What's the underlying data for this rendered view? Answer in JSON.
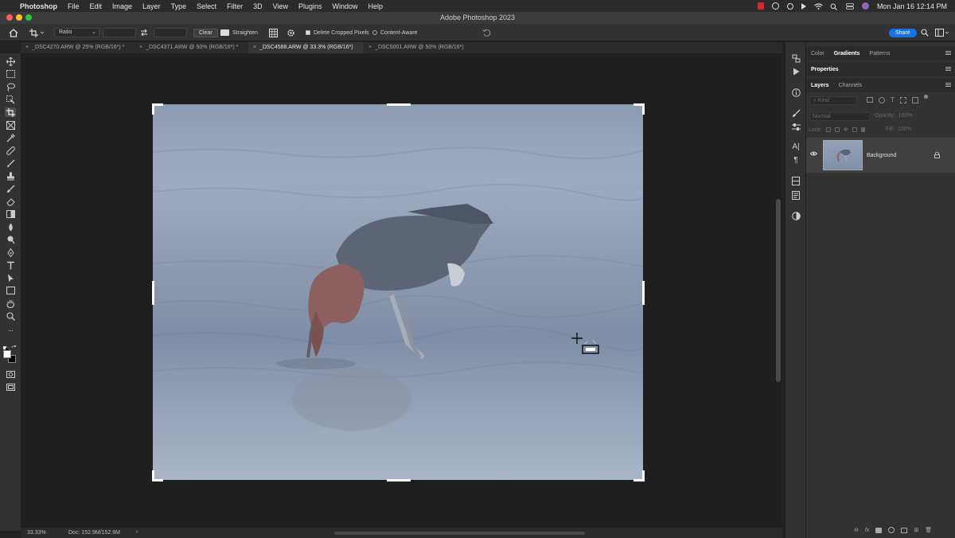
{
  "menubar": {
    "app_name": "Photoshop",
    "items": [
      "File",
      "Edit",
      "Image",
      "Layer",
      "Type",
      "Select",
      "Filter",
      "3D",
      "View",
      "Plugins",
      "Window",
      "Help"
    ],
    "datetime": "Mon Jan 16  12:14 PM"
  },
  "window": {
    "title": "Adobe Photoshop 2023"
  },
  "options": {
    "ratio_label": "Ratio",
    "clear_label": "Clear",
    "straighten_label": "Straighten",
    "delete_cropped_label": "Delete Cropped Pixels",
    "delete_cropped_checked": true,
    "content_aware_label": "Content-Aware",
    "share_label": "Share"
  },
  "tabs": [
    {
      "label": "_DSC4270.ARW @ 25% (RGB/16*) *",
      "active": false
    },
    {
      "label": "_DSC4371.ARW @ 50% (RGB/16*) *",
      "active": false
    },
    {
      "label": "_DSC4588.ARW @ 33.3% (RGB/16*)",
      "active": true
    },
    {
      "label": "_DSC5001.ARW @ 50% (RGB/16*)",
      "active": false
    }
  ],
  "status": {
    "zoom": "33.33%",
    "doc": "Doc: 152.9M/152.9M",
    "arrow": "›"
  },
  "panels": {
    "top_tabs": [
      "Color",
      "Gradients",
      "Patterns"
    ],
    "top_active": "Gradients",
    "properties_label": "Properties",
    "layer_tabs": [
      "Layers",
      "Channels"
    ],
    "layers_active": "Layers",
    "kind_placeholder": "Kind",
    "blend_mode": "Normal",
    "opacity_label": "Opacity:",
    "opacity_value": "100%",
    "lock_label": "Lock:",
    "fill_label": "Fill:",
    "fill_value": "100%",
    "layer_name": "Background"
  }
}
